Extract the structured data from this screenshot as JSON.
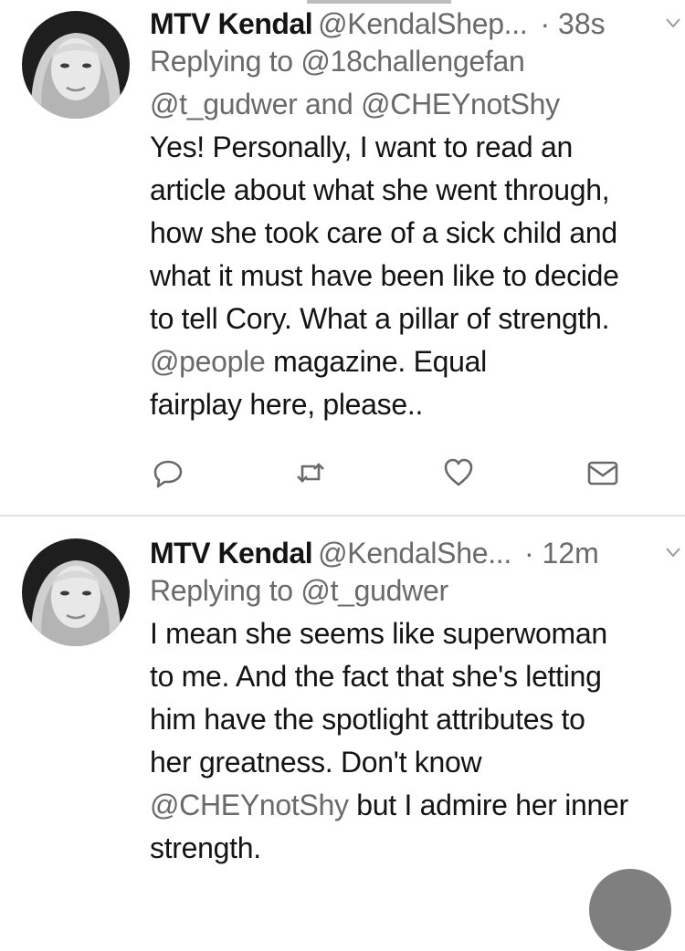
{
  "tweets": [
    {
      "display_name": "MTV Kendal",
      "handle": "@KendalShep...",
      "timestamp": "· 38s",
      "replying_prefix": "Replying to ",
      "replying_mention1": "@18challengefan",
      "replying_mention2": "@t_gudwer",
      "replying_and": " and ",
      "replying_mention3": "@CHEYnotShy",
      "body_lines": [
        "Yes! Personally, I want to read an",
        "article about what she went through,",
        "how she took care of a sick child and",
        "what it must have been like to decide",
        "to tell Cory. What a pillar of strength."
      ],
      "line6_mention": "@people",
      "line6_rest": " magazine. Equal",
      "line7": "fairplay here, please.."
    },
    {
      "display_name": "MTV Kendal",
      "handle": "@KendalShe...",
      "timestamp": "· 12m",
      "replying_prefix": "Replying to ",
      "replying_mention1": "@t_gudwer",
      "body_lines": [
        "I mean she seems like superwoman",
        "to me. And the fact that she's letting",
        "him have the spotlight attributes to",
        "her greatness. Don't know"
      ],
      "line5_mention": "@CHEYnotShy",
      "line5_rest": " but I admire her inner",
      "line6": "strength."
    }
  ],
  "actions": [
    "reply-icon",
    "retweet-icon",
    "like-icon",
    "direct-message-icon"
  ],
  "colors": {
    "text": "#141414",
    "muted": "#6a6a6a",
    "divider": "#e3e3e3",
    "icon": "#6a6a6a"
  }
}
